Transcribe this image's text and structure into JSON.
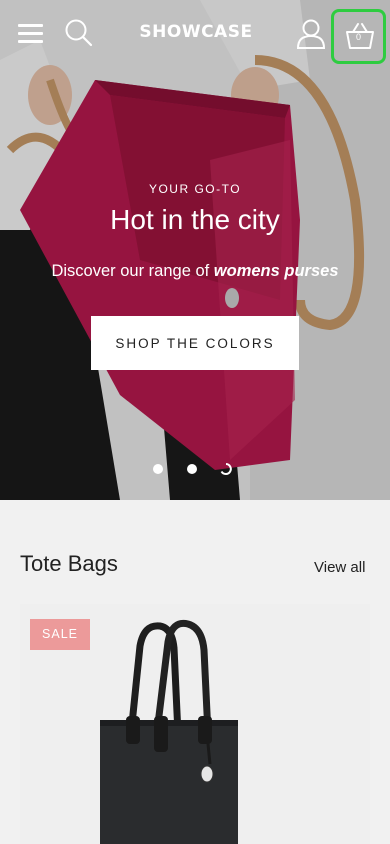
{
  "header": {
    "logo": "SHOWCASE",
    "cart_count": "0"
  },
  "hero": {
    "eyebrow": "YOUR GO-TO",
    "title": "Hot in the city",
    "subtitle_prefix": "Discover our range of ",
    "subtitle_emphasis": "womens purses",
    "cta_label": "SHOP THE COLORS",
    "slides_total": 3,
    "active_slide": 3
  },
  "section": {
    "title": "Tote Bags",
    "view_all": "View all"
  },
  "products": [
    {
      "badge": "SALE"
    }
  ],
  "colors": {
    "cart_highlight": "#2ecc40",
    "sale_badge": "#ec9a9a",
    "bag_magenta": "#b8194f",
    "strap_tan": "#c89a6a"
  }
}
